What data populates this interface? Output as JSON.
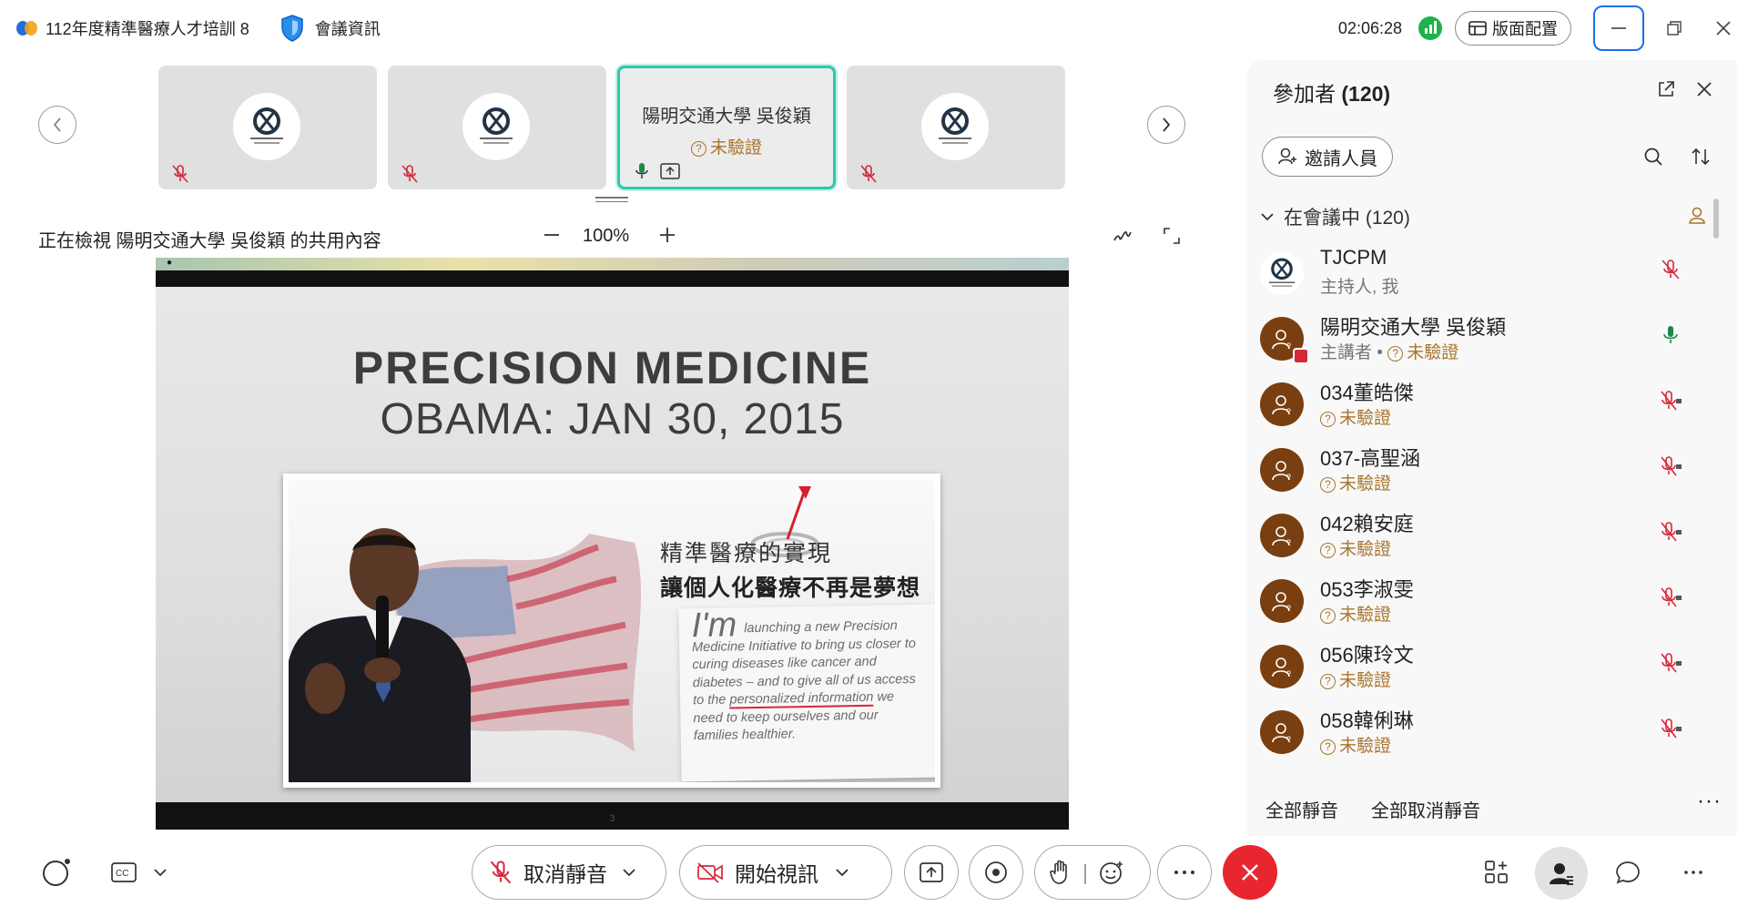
{
  "titlebar": {
    "meeting_title": "112年度精準醫療人才培訓 8",
    "meeting_info": "會議資訊",
    "timer": "02:06:28",
    "layout_label": "版面配置"
  },
  "strip": {
    "tiles": [
      {
        "name": "",
        "status": ""
      },
      {
        "name": "",
        "status": ""
      },
      {
        "name": "陽明交通大學 吳俊穎",
        "status": "未驗證"
      },
      {
        "name": "",
        "status": ""
      }
    ]
  },
  "share": {
    "viewing_text": "正在檢視 陽明交通大學 吳俊穎 的共用內容",
    "zoom": "100%"
  },
  "slide": {
    "title": "PRECISION MEDICINE",
    "subtitle": "OBAMA: JAN 30, 2015",
    "headline_zh_1": "精準醫療的實現",
    "headline_zh_2": "讓個人化醫療不再是夢想",
    "quote_lead": "I'm",
    "quote_body_1": "launching a new Precision Medicine Initiative to bring us closer to curing diseases like cancer and diabetes – and to give all of us access to the",
    "quote_highlight": "personalized information",
    "quote_body_2": "we need to keep ourselves and our families healthier.",
    "page_number": "3"
  },
  "panel": {
    "title": "參加者",
    "count": "(120)",
    "invite_label": "邀請人員",
    "section_label": "在會議中 (120)",
    "participants": [
      {
        "name": "TJCPM",
        "sub": "主持人, 我",
        "type": "host",
        "mic": "muted"
      },
      {
        "name": "陽明交通大學 吳俊穎",
        "sub": "主講者 • ",
        "sub2": "未驗證",
        "type": "presenter",
        "mic": "on"
      },
      {
        "name": "034董皓傑",
        "sub": "未驗證",
        "type": "guest",
        "mic": "muted-locked"
      },
      {
        "name": "037-高聖涵",
        "sub": "未驗證",
        "type": "guest",
        "mic": "muted-locked"
      },
      {
        "name": "042賴安庭",
        "sub": "未驗證",
        "type": "guest",
        "mic": "muted-locked"
      },
      {
        "name": "053李淑雯",
        "sub": "未驗證",
        "type": "guest",
        "mic": "muted-locked"
      },
      {
        "name": "056陳玲文",
        "sub": "未驗證",
        "type": "guest",
        "mic": "muted-locked"
      },
      {
        "name": "058韓俐琳",
        "sub": "未驗證",
        "type": "guest",
        "mic": "muted-locked"
      }
    ],
    "mute_all": "全部靜音",
    "unmute_all": "全部取消靜音"
  },
  "controls": {
    "unmute_label": "取消靜音",
    "video_label": "開始視訊"
  },
  "colors": {
    "accent_teal": "#2fc8a8",
    "end_red": "#e8262f",
    "muted_red": "#d6283a",
    "unverified_brown": "#a8752e",
    "avatar_brown": "#7a3f10"
  }
}
